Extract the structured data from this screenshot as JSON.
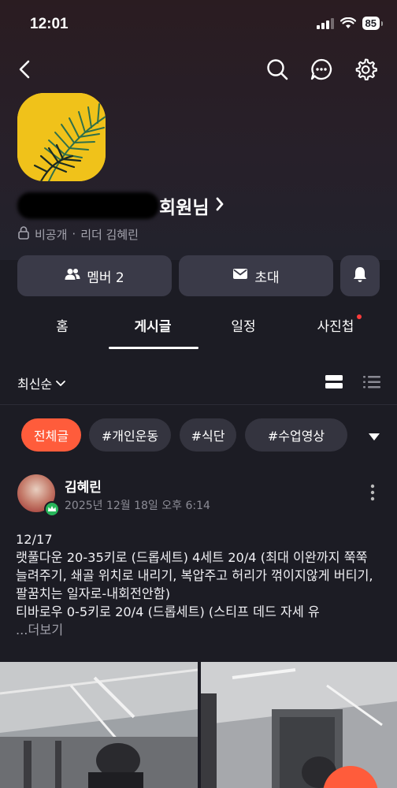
{
  "status_bar": {
    "time": "12:01",
    "battery": "85"
  },
  "group": {
    "title_suffix": "회원님",
    "privacy": "비공개",
    "separator": "·",
    "leader": "리더 김혜린"
  },
  "actions": {
    "member_label": "멤버 2",
    "invite_label": "초대"
  },
  "tabs": [
    {
      "label": "홈"
    },
    {
      "label": "게시글"
    },
    {
      "label": "일정"
    },
    {
      "label": "사진첩"
    }
  ],
  "sort": {
    "label": "최신순"
  },
  "chips": [
    {
      "label": "전체글"
    },
    {
      "label": "#개인운동"
    },
    {
      "label": "#식단"
    },
    {
      "label": "#수업영상"
    }
  ],
  "post": {
    "author": "김혜린",
    "date": "2025년 12월 18일 오후 6:14",
    "body": "12/17\n랫풀다운 20-35키로 (드롭세트) 4세트 20/4 (최대 이완까지 쭉쭉 늘려주기, 쇄골 위치로 내리기, 복압주고 허리가 꺾이지않게 버티기, 팔꿈치는 일자로-내회전안함)\n티바로우 0-5키로 20/4 (드롭세트) (스티프 데드 자세 유",
    "more_label": "...더보기"
  },
  "colors": {
    "accent": "#ff5c3b",
    "background": "#1c1c24",
    "card": "#3a3a48",
    "badge": "#27b65a"
  },
  "icons": [
    "back-icon",
    "search-icon",
    "chat-icon",
    "gear-icon",
    "lock-icon",
    "members-icon",
    "mail-icon",
    "bell-icon",
    "chevron-down-icon",
    "card-view-icon",
    "list-view-icon",
    "more-vertical-icon",
    "crown-icon"
  ]
}
